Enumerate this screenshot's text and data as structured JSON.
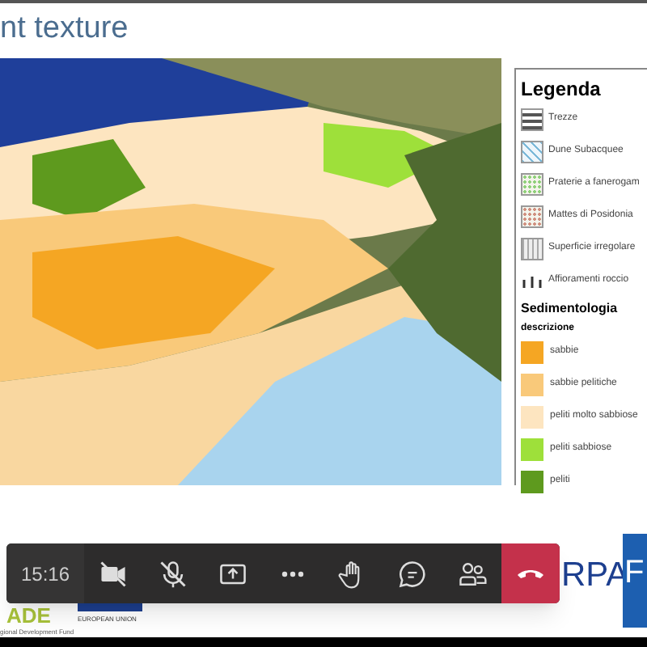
{
  "slide": {
    "title": "nt texture",
    "legend": {
      "title": "Legenda",
      "habitats": [
        {
          "label": "Trezze",
          "kind": "dense",
          "color": "#555555"
        },
        {
          "label": "Dune Subacquee",
          "kind": "waves",
          "color": "#7ab8d8"
        },
        {
          "label": "Praterie a fanerogam",
          "kind": "dots",
          "color": "#8fd07a"
        },
        {
          "label": "Mattes di Posidonia",
          "kind": "dots",
          "color": "#d09080"
        },
        {
          "label": "Superficie irregolare",
          "kind": "grid",
          "color": "#aaaaaa"
        },
        {
          "label": "Affioramenti roccio",
          "kind": "symbol",
          "color": "#333333"
        }
      ],
      "section": "Sedimentologia",
      "subheading": "descrizione",
      "sediments": [
        {
          "label": "sabbie",
          "color": "#f5a623"
        },
        {
          "label": "sabbie pelitiche",
          "color": "#f9c97a"
        },
        {
          "label": "peliti molto sabbiose",
          "color": "#fde5c0"
        },
        {
          "label": "peliti sabbiose",
          "color": "#9ee03a"
        },
        {
          "label": "peliti",
          "color": "#5e9a1e"
        }
      ]
    },
    "footer": {
      "left_logo_text": "ADE",
      "left_logo_caption": "gional Development Fund",
      "eu_caption": "EUROPEAN UNION",
      "right_logo_text": "RPA",
      "right_logo_box": "F"
    }
  },
  "call_toolbar": {
    "time": "15:16",
    "buttons": [
      {
        "kind": "camera",
        "on": false
      },
      {
        "kind": "mic",
        "on": false
      },
      {
        "kind": "share"
      },
      {
        "kind": "more"
      },
      {
        "kind": "hand"
      },
      {
        "kind": "chat"
      },
      {
        "kind": "people"
      },
      {
        "kind": "hangup"
      }
    ]
  }
}
